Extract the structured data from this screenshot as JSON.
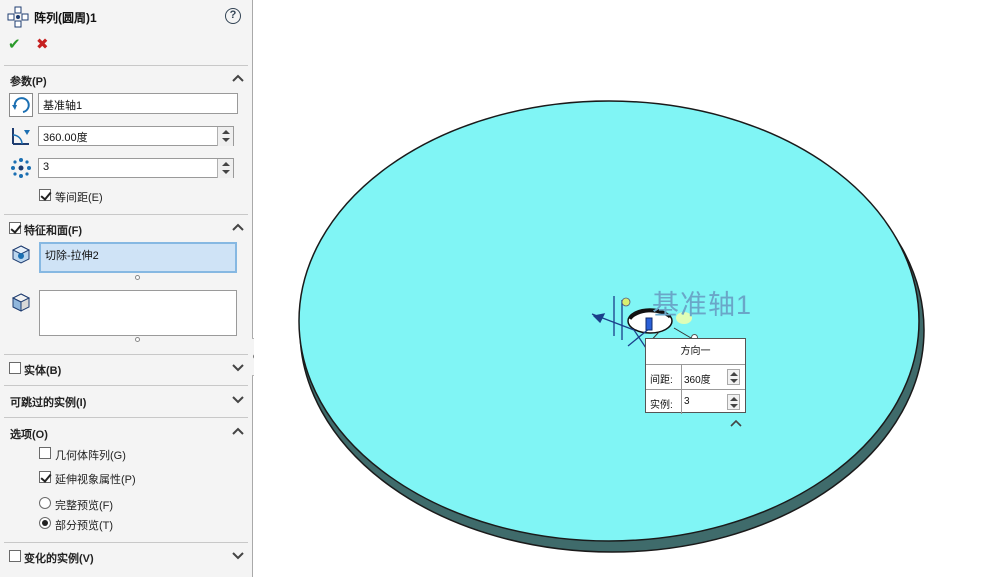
{
  "property_manager": {
    "title": "阵列(圆周)1",
    "help": "?",
    "ok": "✔",
    "cancel": "✖",
    "parameters": {
      "header": "参数(P)",
      "axis_value": "基准轴1",
      "angle_value": "360.00度",
      "instances_value": "3",
      "equal_spacing_label": "等间距(E)",
      "equal_spacing_checked": true
    },
    "features_faces": {
      "header": "特征和面(F)",
      "checked": true,
      "features_list": [
        "切除-拉伸2"
      ],
      "faces_list": []
    },
    "bodies": {
      "header": "实体(B)",
      "checked": false
    },
    "skip_instances": {
      "header": "可跳过的实例(I)"
    },
    "options": {
      "header": "选项(O)",
      "geometry_pattern_label": "几何体阵列(G)",
      "geometry_pattern_checked": false,
      "propagate_visual_label": "延伸视象属性(P)",
      "propagate_visual_checked": true,
      "full_preview_label": "完整预览(F)",
      "partial_preview_label": "部分预览(T)",
      "preview_mode": "partial"
    },
    "vary_instances": {
      "header": "变化的实例(V)",
      "checked": false
    }
  },
  "viewport": {
    "axis_label": "基准轴1",
    "disc_color": "#80f5f5",
    "callout": {
      "title": "方向一",
      "spacing_label": "间距:",
      "spacing_value": "360度",
      "instances_label": "实例:",
      "instances_value": "3"
    }
  }
}
